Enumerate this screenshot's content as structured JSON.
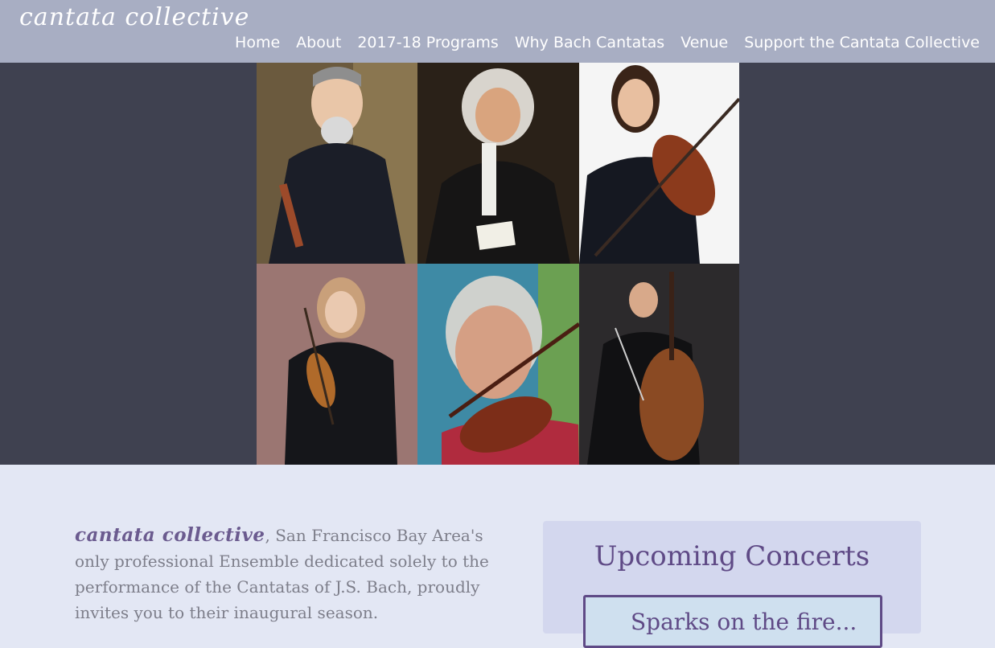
{
  "header": {
    "logo": "cantata collective",
    "nav": [
      "Home",
      "About",
      "2017-18 Programs",
      "Why Bach Cantatas",
      "Venue",
      "Support the Cantata Collective"
    ]
  },
  "intro": {
    "brand": "cantata collective",
    "text": ", San Francisco Bay Area's only professional Ensemble dedicated solely to the performance of the Cantatas of J.S. Bach, proudly invites you to their inaugural season."
  },
  "concerts": {
    "title": "Upcoming Concerts",
    "card_text": "Sparks on the fire..."
  }
}
